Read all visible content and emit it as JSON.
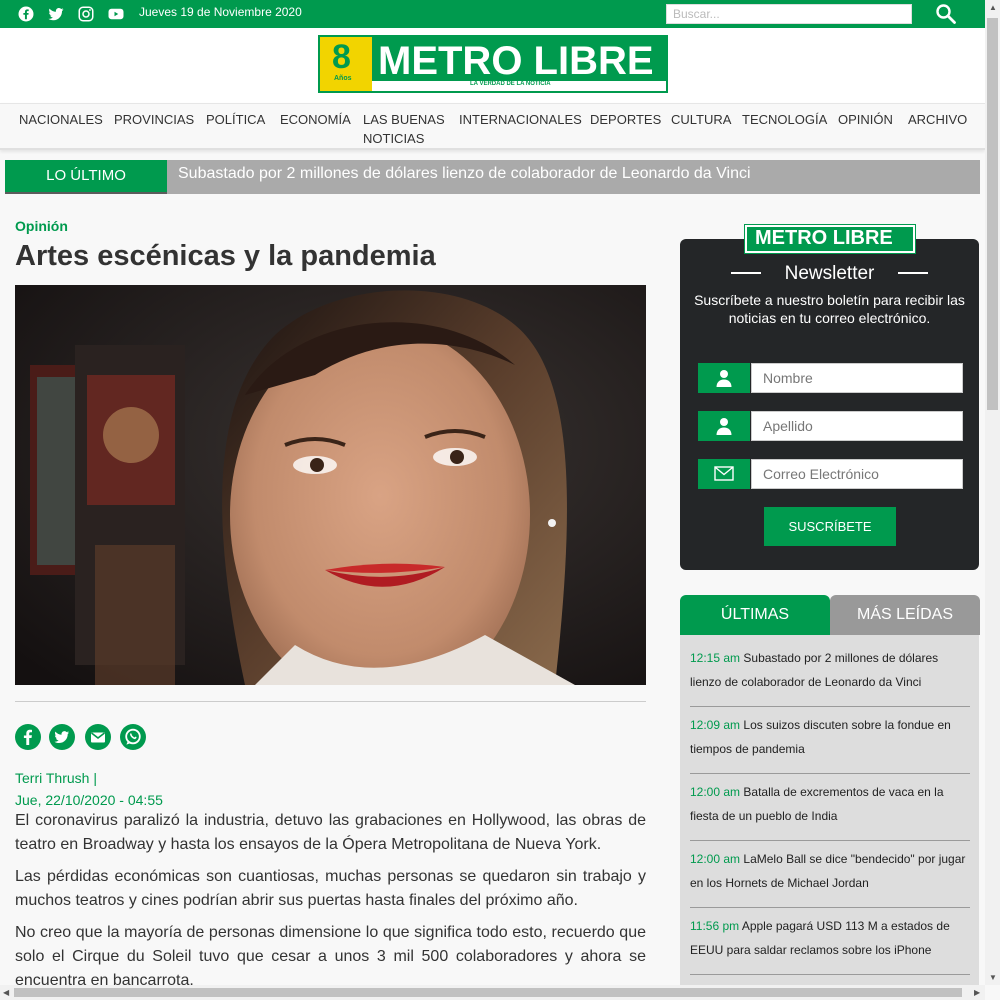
{
  "topbar": {
    "date": "Jueves 19 de Noviembre 2020",
    "search_placeholder": "Buscar...",
    "social": [
      "facebook-icon",
      "twitter-icon",
      "instagram-icon",
      "youtube-icon"
    ]
  },
  "logo": {
    "number": "8",
    "anos": "Años",
    "name": "METRO LIBRE",
    "tagline": "LA VERDAD DE LA NOTICIA"
  },
  "nav": {
    "items": [
      "NACIONALES",
      "PROVINCIAS",
      "POLÍTICA",
      "ECONOMÍA",
      "LAS BUENAS",
      "NOTICIAS",
      "INTERNACIONALES",
      "DEPORTES",
      "CULTURA",
      "TECNOLOGÍA",
      "OPINIÓN",
      "ARCHIVO"
    ]
  },
  "breaking": {
    "label": "LO ÚLTIMO",
    "headline": "Subastado por 2 millones de dólares lienzo de colaborador de Leonardo da Vinci"
  },
  "article": {
    "section": "Opinión",
    "title": "Artes escénicas y la pandemia",
    "author": "Terri Thrush |",
    "date": "Jue, 22/10/2020 - 04:55",
    "paragraphs": [
      "El coronavirus paralizó la industria, detuvo las grabaciones en Hollywood, las obras de teatro en Broadway y hasta los ensayos de la Ópera Metropolitana de Nueva York.",
      "Las pérdidas económicas son cuantiosas, muchas personas se quedaron sin trabajo y muchos teatros y cines podrían abrir sus puertas hasta finales del próximo año.",
      "No creo que la mayoría de personas dimensione lo que significa todo esto, recuerdo  que solo el Cirque du Soleil tuvo que cesar a unos 3 mil 500 colaboradores y ahora se encuentra en bancarrota."
    ],
    "share": [
      "facebook-share-icon",
      "twitter-share-icon",
      "email-share-icon",
      "whatsapp-share-icon"
    ]
  },
  "newsletter": {
    "logo": "METRO LIBRE",
    "title": "Newsletter",
    "subtitle": "Suscríbete a nuestro boletín para recibir las noticias en tu correo electrónico.",
    "fields": {
      "name": "Nombre",
      "lastname": "Apellido",
      "email": "Correo Electrónico"
    },
    "button": "SUSCRÍBETE"
  },
  "tabs": {
    "active": "ÚLTIMAS",
    "inactive": "MÁS LEÍDAS"
  },
  "latest": [
    {
      "time": "12:15 am",
      "title": "Subastado por 2 millones de dólares lienzo de colaborador de Leonardo da Vinci"
    },
    {
      "time": "12:09 am",
      "title": "Los suizos discuten sobre la fondue en tiempos de pandemia"
    },
    {
      "time": "12:00 am",
      "title": "Batalla de excrementos de vaca en la fiesta de un pueblo de India"
    },
    {
      "time": "12:00 am",
      "title": "LaMelo Ball se dice \"bendecido\" por jugar en los Hornets de Michael Jordan"
    },
    {
      "time": "11:56 pm",
      "title": "Apple pagará USD 113 M a estados de EEUU para saldar reclamos sobre los iPhone"
    }
  ],
  "colors": {
    "brand_green": "#009a4e",
    "dark_panel": "#242628",
    "gray_tab": "#999999"
  }
}
